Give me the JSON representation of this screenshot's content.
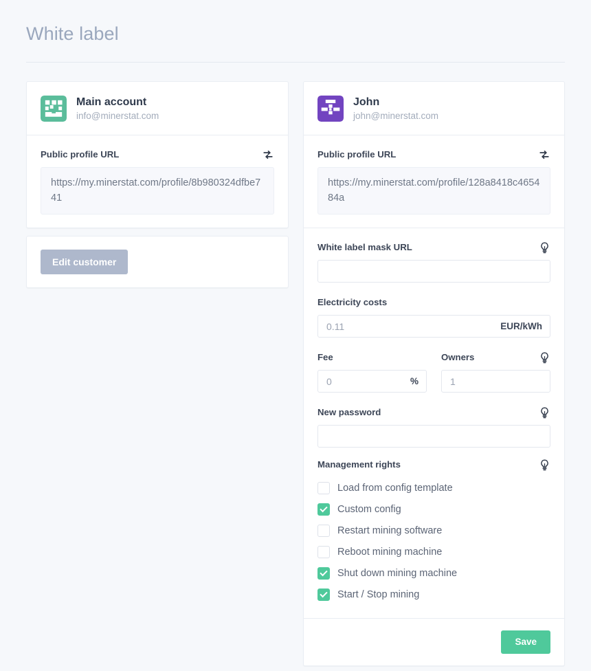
{
  "page": {
    "title": "White label",
    "background_color": "#f6f8fb"
  },
  "colors": {
    "accent_green": "#4fc99b",
    "avatar_green": "#5bbd9b",
    "avatar_purple": "#7244c0",
    "edit_button": "#aeb8cc",
    "title_text": "#9aa7bd"
  },
  "left_card": {
    "account": {
      "name": "Main account",
      "email": "info@minerstat.com",
      "avatar_icon": "identicon-avatar",
      "avatar_color": "#5bbd9b"
    },
    "public_profile": {
      "label": "Public profile URL",
      "refresh_icon": "sync-refresh-icon",
      "url": "https://my.minerstat.com/profile/8b980324dfbe741"
    },
    "edit_button_label": "Edit customer"
  },
  "right_card": {
    "account": {
      "name": "John",
      "email": "john@minerstat.com",
      "avatar_icon": "identicon-avatar",
      "avatar_color": "#7244c0"
    },
    "public_profile": {
      "label": "Public profile URL",
      "refresh_icon": "sync-refresh-icon",
      "url": "https://my.minerstat.com/profile/128a8418c465484a"
    },
    "fields": {
      "mask_url": {
        "label": "White label mask URL",
        "value": "",
        "placeholder": "",
        "help_icon": "lightbulb-icon"
      },
      "electricity": {
        "label": "Electricity costs",
        "value": "",
        "placeholder": "0.11",
        "suffix": "EUR/kWh"
      },
      "fee": {
        "label": "Fee",
        "value": "",
        "placeholder": "0",
        "suffix": "%"
      },
      "owners": {
        "label": "Owners",
        "value": "",
        "placeholder": "1",
        "help_icon": "lightbulb-icon"
      },
      "new_password": {
        "label": "New password",
        "value": "",
        "placeholder": "",
        "help_icon": "lightbulb-icon"
      }
    },
    "management_rights": {
      "label": "Management rights",
      "help_icon": "lightbulb-icon",
      "options": [
        {
          "label": "Load from config template",
          "checked": false
        },
        {
          "label": "Custom config",
          "checked": true
        },
        {
          "label": "Restart mining software",
          "checked": false
        },
        {
          "label": "Reboot mining machine",
          "checked": false
        },
        {
          "label": "Shut down mining machine",
          "checked": true
        },
        {
          "label": "Start / Stop mining",
          "checked": true
        }
      ]
    },
    "save_button_label": "Save"
  }
}
